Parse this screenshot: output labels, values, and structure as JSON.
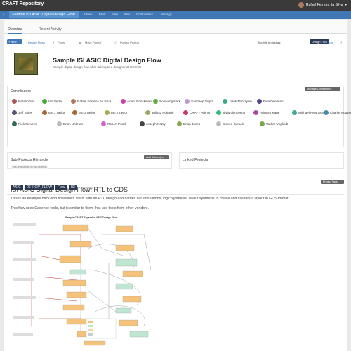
{
  "app": {
    "logo": "CRAFT Repository",
    "user_name": "Rafael Ferreira da Silva"
  },
  "nav": {
    "back": "‹",
    "title": "Sample ISI ASIC Digital Design Flow",
    "items": [
      "Admin",
      "Flow",
      "Files",
      "Wiki",
      "Contributors",
      "Settings"
    ]
  },
  "tabs": [
    "Overview",
    "Recent Activity"
  ],
  "actions": {
    "new": "New",
    "design_flows": "Design Flows",
    "forks": "Forks",
    "move": "Move Project",
    "publish": "Publish Project",
    "tag_label": "Tag this project as:",
    "tag_value": "Design Flow",
    "core": "Core"
  },
  "project": {
    "title": "Sample ISI ASIC Digital Design Flow",
    "subtitle": "Sample digital design flow after talking to a designer at USC/ISI"
  },
  "contributors": {
    "heading": "Contributors",
    "manage": "Manage Contributors",
    "rows": [
      [
        [
          "Karan Vahi",
          "#a55"
        ],
        [
          "Ian Taylor",
          "#4a3"
        ],
        [
          "Rafael Ferreira da Silva",
          "#b07860"
        ],
        [
          "Adam Brinckman",
          "#c4a"
        ],
        [
          "Soowang Park",
          "#6a4"
        ],
        [
          "Sandeep Gupta",
          "#b9c"
        ],
        [
          "Jarek Nabrzyski",
          "#3a8"
        ],
        [
          "Ewa Deelman",
          "#548"
        ]
      ],
      [
        [
          "Jeff Spies",
          "#557"
        ],
        [
          "Ian J Taylor",
          "#a63"
        ],
        [
          "Ian J Taylor",
          "#a63"
        ],
        [
          "Ian J Taylor",
          "#aa5"
        ],
        [
          "Juliusz Pukacki",
          "#9a6"
        ],
        [
          "CRAFT Admin",
          "#c36"
        ],
        [
          "silviu chincescu",
          "#3b7"
        ],
        [
          "Avinash Kane",
          "#a4a"
        ],
        [
          "Michael Newhouse",
          "#4a9"
        ],
        [
          "Charlie Nguyen",
          "#48a"
        ]
      ],
      [
        [
          "Rick Stevens",
          "#365"
        ],
        [
          "Brian Uhlhorn",
          "#bbb"
        ],
        [
          "Robert Pond",
          "#c6c"
        ],
        [
          "Joseph Kozry",
          "#444"
        ],
        [
          "Brian Jones",
          "#8a5"
        ],
        [
          "Steven Burack",
          "#bbb"
        ],
        [
          "Walter Unglaub",
          "#7a4"
        ]
      ]
    ]
  },
  "subprojects": {
    "heading": "Sub-Projects Hierarchy",
    "add": "Add Subproject",
    "hint": "This project has no sub-projects"
  },
  "linked": {
    "heading": "Linked Projects"
  },
  "tags": {
    "items": [
      "ASIC",
      "DESIGN_FLOW",
      "Flow",
      "ISI"
    ],
    "add": "add a tag",
    "project_tags": "Project Tags"
  },
  "description": {
    "title": "ISI ASIC Digital Design Flow: RTL to GDS",
    "p1": "This is an example back-end flow which starts with an RTL design and carries out simulations, logic synthesis, layout synthesis to create and validate a layout in GDS format.",
    "p2": "This flow uses Cadence tools, but is similar to flows that use tools from other vendors.",
    "diagram_title": "Sample CRAFT Expanded ASIC Design Flow"
  }
}
